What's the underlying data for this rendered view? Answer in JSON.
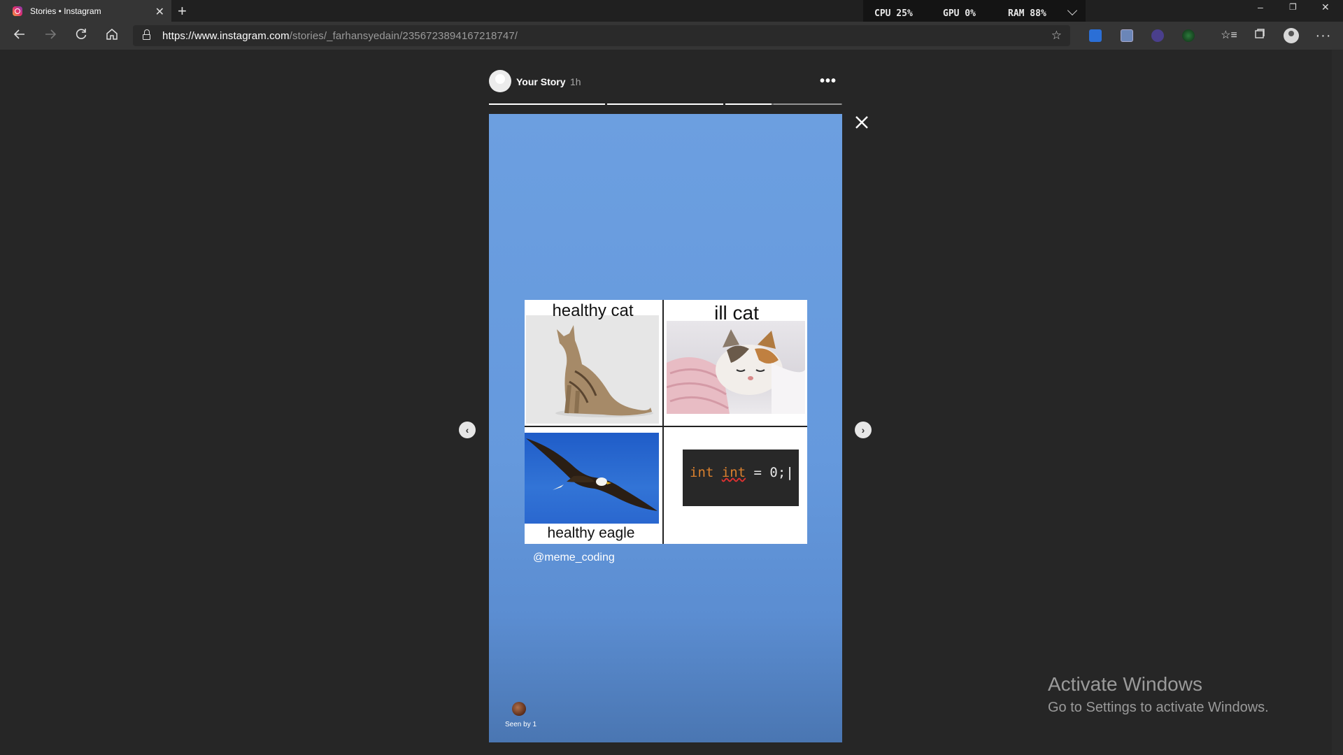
{
  "browser": {
    "tab_title": "Stories • Instagram",
    "tab_close": "✕",
    "new_tab": "+",
    "url_host": "https://www.instagram.com",
    "url_path": "/stories/_farhansyedain/2356723894167218747/",
    "perf": {
      "cpu": "CPU  25%",
      "gpu": "GPU  0%",
      "ram": "RAM  88%"
    },
    "window_controls": {
      "minimize": "–",
      "restore": "❐",
      "close": "✕"
    }
  },
  "story": {
    "user": "Your Story",
    "time": "1h",
    "more": "•••",
    "progress": [
      1.0,
      1.0,
      0.4,
      0.0
    ],
    "mention": "@meme_coding",
    "seen_by": "Seen by 1"
  },
  "meme": {
    "top_left": "healthy cat",
    "top_right": "ill cat",
    "bottom_left": "healthy eagle",
    "code_kw": "int",
    "code_ident": "int",
    "code_rest": " = 0;"
  },
  "watermark": {
    "title": "Activate Windows",
    "subtitle": "Go to Settings to activate Windows."
  },
  "colors": {
    "story_background": "#6599dd",
    "code_keyword": "#d9802e"
  }
}
